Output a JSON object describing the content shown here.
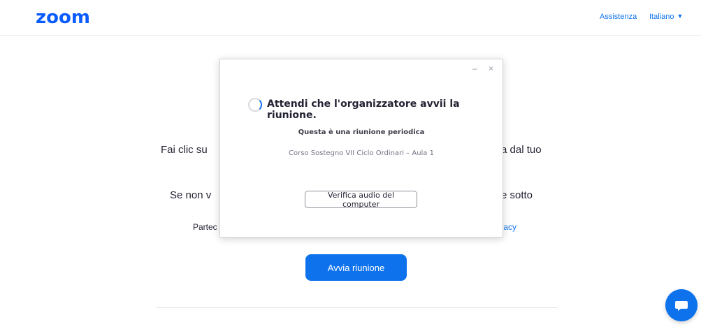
{
  "header": {
    "logo": "zoom",
    "support_link": "Assistenza",
    "language": "Italiano"
  },
  "background": {
    "line1_left": "Fai clic su",
    "line1_right": "a dal tuo",
    "line2_left": "Se non v",
    "line2_right": "e sotto",
    "line3_left": "Partec",
    "line3_right": "/acy",
    "start_button": "Avvia riunione"
  },
  "dialog": {
    "minimize": "–",
    "close": "×",
    "title": "Attendi che l'organizzatore avvii la riunione.",
    "subtitle": "Questa è una riunione periodica",
    "meeting_name": "Corso Sostegno VII Ciclo Ordinari – Aula 1",
    "audio_button": "Verifica audio del computer"
  },
  "colors": {
    "brand": "#0b5cff",
    "link": "#0e72ed",
    "button": "#0e72ed"
  },
  "icons": {
    "chat": "chat-bubble-icon",
    "spinner": "loading-spinner-icon",
    "caret": "caret-down-icon"
  }
}
